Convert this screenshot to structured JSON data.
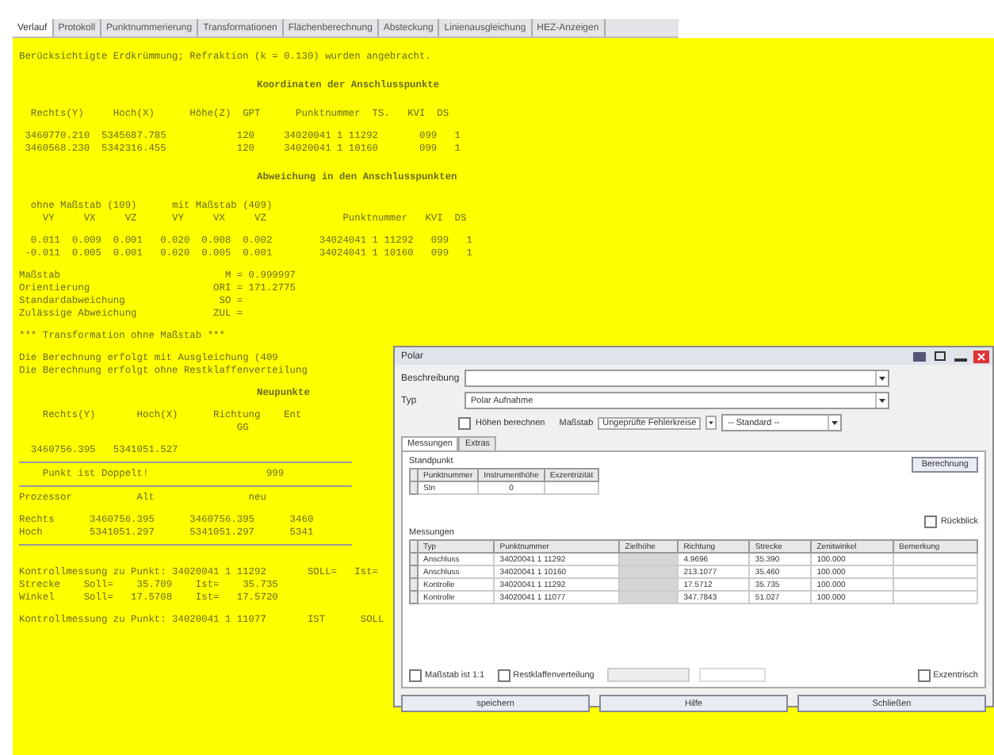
{
  "tabs": [
    {
      "label": "Verlauf",
      "selected": true
    },
    {
      "label": "Protokoll",
      "selected": false
    },
    {
      "label": "Punktnummerierung",
      "selected": false
    },
    {
      "label": "Transformationen",
      "selected": false
    },
    {
      "label": "Flächenberechnung",
      "selected": false
    },
    {
      "label": "Absteckung",
      "selected": false
    },
    {
      "label": "Linienausgleichung",
      "selected": false
    },
    {
      "label": "HEZ-Anzeigen",
      "selected": false
    }
  ],
  "report": [
    {
      "kind": "text",
      "text": "Berücksichtigte Erdkrümmung; Refraktion (k = 0.130) wurden angebracht."
    },
    {
      "kind": "gap"
    },
    {
      "kind": "heading",
      "text": "Koordinaten der Anschlusspunkte"
    },
    {
      "kind": "gap"
    },
    {
      "kind": "text",
      "text": "  Rechts(Y)     Hoch(X)      Höhe(Z)  GPT      Punktnummer  TS.   KVI  DS"
    },
    {
      "kind": "half"
    },
    {
      "kind": "text",
      "text": " 3460770.210  5345687.785            120     34020041 1 11292       099   1"
    },
    {
      "kind": "text",
      "text": " 3460568.230  5342316.455            120     34020041 1 10160       099   1"
    },
    {
      "kind": "gap"
    },
    {
      "kind": "heading",
      "text": "Abweichung in den Anschlusspunkten"
    },
    {
      "kind": "gap"
    },
    {
      "kind": "text",
      "text": "  ohne Maßstab (109)      mit Maßstab (409)"
    },
    {
      "kind": "text",
      "text": "    VY     VX     VZ      VY     VX     VZ             Punktnummer   KVI  DS"
    },
    {
      "kind": "half"
    },
    {
      "kind": "text",
      "text": "  0.011  0.009  0.001   0.020  0.008  0.002        34024041 1 11292   099   1"
    },
    {
      "kind": "text",
      "text": " -0.011  0.005  0.001   0.020  0.005  0.001        34024041 1 10160   099   1"
    },
    {
      "kind": "half"
    },
    {
      "kind": "text",
      "text": "Maßstab                            M = 0.999997"
    },
    {
      "kind": "text",
      "text": "Orientierung                     ORI = 171.2775"
    },
    {
      "kind": "text",
      "text": "Standardabweichung                SO ="
    },
    {
      "kind": "text",
      "text": "Zulässige Abweichung             ZUL ="
    },
    {
      "kind": "half"
    },
    {
      "kind": "text",
      "text": "*** Transformation ohne Maßstab ***"
    },
    {
      "kind": "half"
    },
    {
      "kind": "text",
      "text": "Die Berechnung erfolgt mit Ausgleichung (409"
    },
    {
      "kind": "text",
      "text": "Die Berechnung erfolgt ohne Restklaffenverteilung"
    },
    {
      "kind": "half"
    },
    {
      "kind": "heading",
      "text": "Neupunkte"
    },
    {
      "kind": "half"
    },
    {
      "kind": "text",
      "text": "    Rechts(Y)       Hoch(X)      Richtung    Ent"
    },
    {
      "kind": "text",
      "text": "                                     GG"
    },
    {
      "kind": "half"
    },
    {
      "kind": "text",
      "text": "  3460756.395   5341051.527"
    },
    {
      "kind": "rule"
    },
    {
      "kind": "text",
      "text": "    Punkt ist Doppelt!                    999"
    },
    {
      "kind": "rule"
    },
    {
      "kind": "text",
      "text": "Prozessor           Alt                neu"
    },
    {
      "kind": "half"
    },
    {
      "kind": "text",
      "text": "Rechts      3460756.395      3460756.395      3460"
    },
    {
      "kind": "text",
      "text": "Hoch        5341051.297      5341051.297      5341"
    },
    {
      "kind": "rule"
    },
    {
      "kind": "gap"
    },
    {
      "kind": "text",
      "text": "Kontrollmessung zu Punkt: 34020041 1 11292       SOLL=   Ist="
    },
    {
      "kind": "text",
      "text": "Strecke    Soll=    35.709    Ist=    35.735"
    },
    {
      "kind": "text",
      "text": "Winkel     Soll=   17.5708    Ist=   17.5720"
    },
    {
      "kind": "half"
    },
    {
      "kind": "text",
      "text": "Kontrollmessung zu Punkt: 34020041 1 11077       IST      SOLL"
    }
  ],
  "dialog": {
    "title": "Polar",
    "description": {
      "label": "Beschreibung"
    },
    "type": {
      "label": "Typ",
      "value": "Polar Aufnahme"
    },
    "heights": {
      "label": "Höhen berechnen",
      "checked": false
    },
    "scale_label": "Maßstab",
    "scale_value": "Ungeprüfte Fehlerkreise",
    "standard": "-- Standard --",
    "tabs": [
      {
        "label": "Messungen",
        "selected": true
      },
      {
        "label": "Extras",
        "selected": false
      }
    ],
    "station": {
      "title": "Standpunkt",
      "columns": [
        "Punktnummer",
        "Instrumenthöhe",
        "Exzentrizität"
      ],
      "rows": [
        [
          "Stn",
          "0",
          ""
        ]
      ]
    },
    "calc_button": "Berechnung",
    "backsight": {
      "label": "Rückblick",
      "checked": false
    },
    "measurements": {
      "title": "Messungen",
      "columns": [
        "Typ",
        "Punktnummer",
        "Zielhöhe",
        "Richtung",
        "Strecke",
        "Zenitwinkel",
        "Bemerkung"
      ],
      "rows": [
        [
          "Anschluss",
          "34020041 1 11292",
          "",
          "4.9696",
          "35.390",
          "100.000",
          ""
        ],
        [
          "Anschluss",
          "34020041 1 10160",
          "",
          "213.1077",
          "35.460",
          "100.000",
          ""
        ],
        [
          "Kontrolle",
          "34020041 1 11292",
          "",
          "17.5712",
          "35.735",
          "100.000",
          ""
        ],
        [
          "Kontrolle",
          "34020041 1 11077",
          "",
          "347.7843",
          "51.027",
          "100.000",
          ""
        ]
      ]
    },
    "scale_one": {
      "label": "Maßstab ist 1:1",
      "checked": false
    },
    "residual": {
      "label": "Restklaffenverteilung",
      "checked": false
    },
    "eccentric": {
      "label": "Exzentrisch",
      "checked": false
    },
    "buttons": [
      "speichern",
      "Hilfe",
      "Schließen"
    ]
  }
}
